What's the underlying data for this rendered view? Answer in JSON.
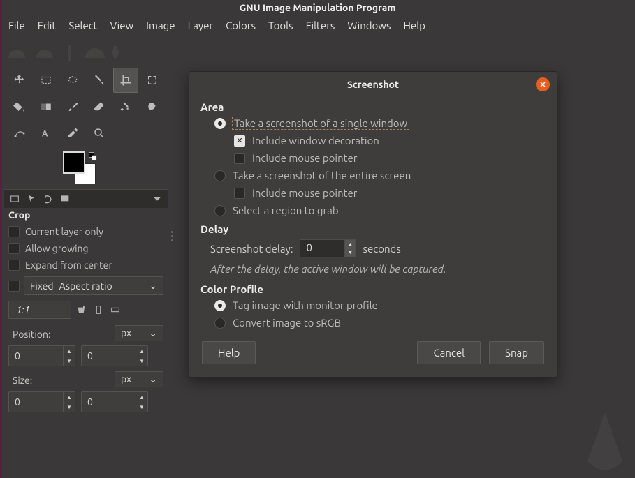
{
  "app_title": "GNU Image Manipulation Program",
  "menu": [
    "File",
    "Edit",
    "Select",
    "View",
    "Image",
    "Layer",
    "Colors",
    "Tools",
    "Filters",
    "Windows",
    "Help"
  ],
  "toolbox_selected_index": 4,
  "tool_options": {
    "title": "Crop",
    "checks": {
      "current_layer_only": "Current layer only",
      "allow_growing": "Allow growing",
      "expand_from_center": "Expand from center",
      "fixed_label": "Fixed",
      "fixed_mode": "Aspect ratio"
    },
    "ratio_value": "1:1",
    "position": {
      "label": "Position:",
      "unit": "px",
      "x": "0",
      "y": "0"
    },
    "size": {
      "label": "Size:",
      "unit": "px",
      "w": "0",
      "h": "0"
    }
  },
  "dialog": {
    "title": "Screenshot",
    "sections": {
      "area": {
        "heading": "Area",
        "single_window": "Take a screenshot of a single window",
        "include_decoration": "Include window decoration",
        "include_pointer_1": "Include mouse pointer",
        "entire_screen": "Take a screenshot of the entire screen",
        "include_pointer_2": "Include mouse pointer",
        "select_region": "Select a region to grab"
      },
      "delay": {
        "heading": "Delay",
        "label": "Screenshot delay:",
        "value": "0",
        "unit": "seconds",
        "hint": "After the delay, the active window will be captured."
      },
      "color": {
        "heading": "Color Profile",
        "tag_monitor": "Tag image with monitor profile",
        "to_srgb": "Convert image to sRGB"
      }
    },
    "buttons": {
      "help": "Help",
      "cancel": "Cancel",
      "snap": "Snap"
    }
  }
}
